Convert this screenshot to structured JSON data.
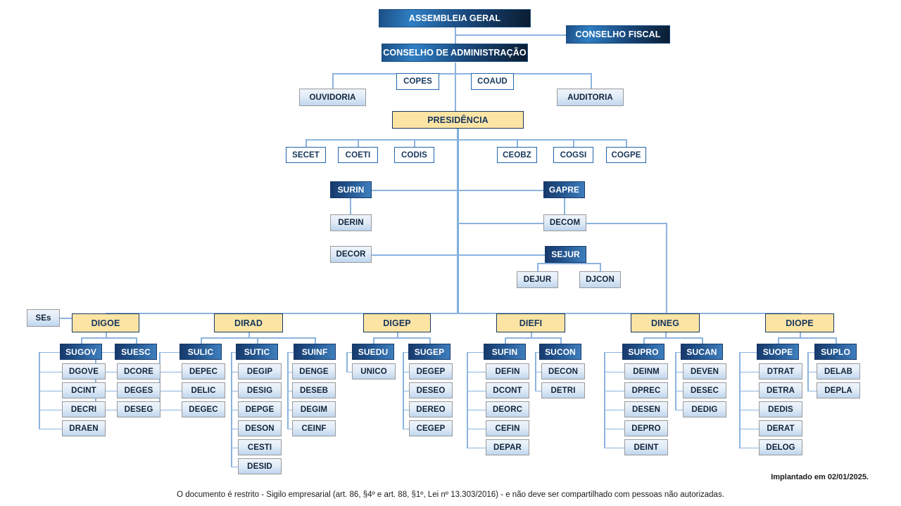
{
  "title": "Organograma",
  "colors": {
    "dark_header": "#17396b",
    "accent_blue": "#2f7fc4",
    "board_yellow": "#fce4a4",
    "department_light": "#dceaf7",
    "line": "#8cb4df",
    "text_dark": "#16365c"
  },
  "top": {
    "assembleia": "ASSEMBLEIA GERAL",
    "conselho_fiscal": "CONSELHO FISCAL",
    "conselho_admin": "CONSELHO DE ADMINISTRAÇÃO",
    "copes": "COPES",
    "coaud": "COAUD",
    "ouvidoria": "OUVIDORIA",
    "auditoria": "AUDITORIA"
  },
  "presidency": {
    "label": "PRESIDÊNCIA",
    "left_committees": [
      "SECET",
      "COETI",
      "CODIS"
    ],
    "right_committees": [
      "CEOBZ",
      "COGSI",
      "COGPE"
    ]
  },
  "staff": {
    "surin": "SURIN",
    "derin": "DERIN",
    "decor": "DECOR",
    "gapre": "GAPRE",
    "decom": "DECOM",
    "sejur": "SEJUR",
    "dejur": "DEJUR",
    "djcon": "DJCON"
  },
  "ses": "SEs",
  "directorates": [
    {
      "name": "DIGOE",
      "superintendencies": [
        {
          "name": "SUGOV",
          "departments": [
            "DGOVE",
            "DCINT",
            "DECRI",
            "DRAEN"
          ]
        },
        {
          "name": "SUESC",
          "departments": [
            "DCORE",
            "DEGES",
            "DESEG"
          ]
        }
      ]
    },
    {
      "name": "DIRAD",
      "superintendencies": [
        {
          "name": "SULIC",
          "departments": [
            "DEPEC",
            "DELIC",
            "DEGEC"
          ]
        },
        {
          "name": "SUTIC",
          "departments": [
            "DEGIP",
            "DESIG",
            "DEPGE",
            "DESON",
            "CESTI",
            "DESID"
          ]
        },
        {
          "name": "SUINF",
          "departments": [
            "DENGE",
            "DESEB",
            "DEGIM",
            "CEINF"
          ]
        }
      ]
    },
    {
      "name": "DIGEP",
      "superintendencies": [
        {
          "name": "SUEDU",
          "departments": [
            "UNICO"
          ]
        },
        {
          "name": "SUGEP",
          "departments": [
            "DEGEP",
            "DESEO",
            "DEREO",
            "CEGEP"
          ]
        }
      ]
    },
    {
      "name": "DIEFI",
      "superintendencies": [
        {
          "name": "SUFIN",
          "departments": [
            "DEFIN",
            "DCONT",
            "DEORC",
            "CEFIN",
            "DEPAR"
          ]
        },
        {
          "name": "SUCON",
          "departments": [
            "DECON",
            "DETRI"
          ]
        }
      ]
    },
    {
      "name": "DINEG",
      "superintendencies": [
        {
          "name": "SUPRO",
          "departments": [
            "DEINM",
            "DPREC",
            "DESEN",
            "DEPRO",
            "DEINT"
          ]
        },
        {
          "name": "SUCAN",
          "departments": [
            "DEVEN",
            "DESEC",
            "DEDIG"
          ]
        }
      ]
    },
    {
      "name": "DIOPE",
      "superintendencies": [
        {
          "name": "SUOPE",
          "departments": [
            "DTRAT",
            "DETRA",
            "DEDIS",
            "DERAT",
            "DELOG"
          ]
        },
        {
          "name": "SUPLO",
          "departments": [
            "DELAB",
            "DEPLA"
          ]
        }
      ]
    }
  ],
  "footer": {
    "implanted": "Implantado em 02/01/2025.",
    "confidential": "O documento é restrito - Sigilo empresarial (art. 86, §4º e art. 88, §1º, Lei nº 13.303/2016) - e não deve ser compartilhado com pessoas não autorizadas."
  }
}
